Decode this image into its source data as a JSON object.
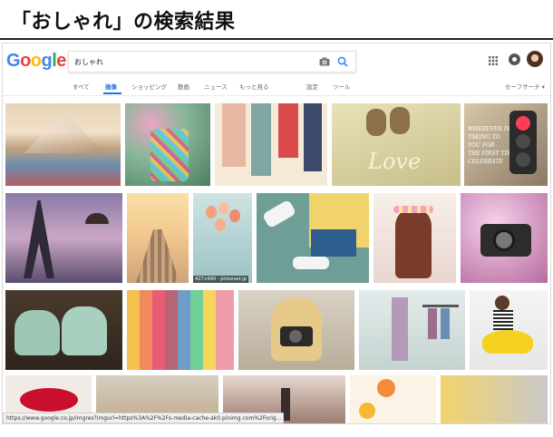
{
  "slide": {
    "title": "「おしゃれ」の検索結果"
  },
  "header": {
    "logo": {
      "g1": "G",
      "o1": "o",
      "o2": "o",
      "g2": "g",
      "l": "l",
      "e": "e"
    },
    "search": {
      "value": "おしゃれ"
    },
    "colors": {
      "blue": "#4285f4",
      "red": "#ea4335",
      "yellow": "#fbbc05",
      "green": "#34a853",
      "accent": "#1a73e8"
    }
  },
  "tabs": [
    {
      "label": "すべて",
      "active": false
    },
    {
      "label": "画像",
      "active": true
    },
    {
      "label": "ショッピング",
      "active": false
    },
    {
      "label": "動画",
      "active": false
    },
    {
      "label": "ニュース",
      "active": false
    },
    {
      "label": "もっと見る",
      "active": false
    },
    {
      "label": "設定",
      "active": false
    },
    {
      "label": "ツール",
      "active": false
    }
  ],
  "safesearch": {
    "label": "セーフサーチ ▾"
  },
  "results": {
    "caption": "427×640 - pinterest.jp",
    "book_text": "WHEREVER IS\nTAKING TO\nYOU FOR\nTHE FIRST TIME\nCELEBRATE"
  },
  "status_bar": {
    "url": "https://www.google.co.jp/imgres?imgurl=https%3A%2F%2Fs-media-cache-ak0.pinimg.com%2Forig..."
  }
}
